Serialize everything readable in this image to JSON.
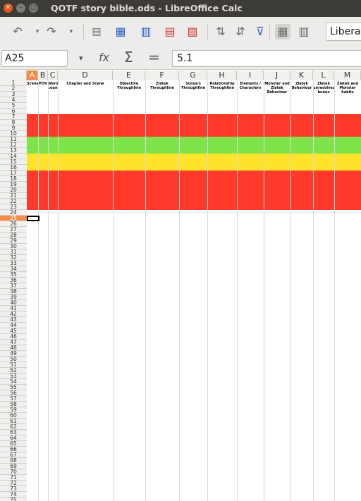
{
  "window": {
    "title": "QOTF story bible.ods - LibreOffice Calc"
  },
  "toolbar": {
    "font_name": "Liberat"
  },
  "formula_bar": {
    "cell_ref": "A25",
    "value": "5.1",
    "function_wizard": "fx",
    "sum": "Σ",
    "equals": "="
  },
  "columns": [
    "A",
    "B",
    "C",
    "D",
    "E",
    "F",
    "G",
    "H",
    "I",
    "J",
    "K",
    "L",
    "M"
  ],
  "selected_column": "A",
  "rows": [
    "1",
    "2",
    "3",
    "4",
    "5",
    "6",
    "7",
    "8",
    "9",
    "10",
    "11",
    "12",
    "13",
    "14",
    "15",
    "16",
    "17",
    "18",
    "19",
    "20",
    "21",
    "22",
    "23",
    "24",
    "25",
    "26",
    "27",
    "28",
    "29",
    "30",
    "31",
    "32",
    "33",
    "34",
    "35",
    "36",
    "37",
    "38",
    "39",
    "40",
    "41",
    "42",
    "43",
    "44",
    "45",
    "46",
    "47",
    "48",
    "49",
    "50",
    "51",
    "52",
    "53",
    "54",
    "55",
    "56",
    "57",
    "58",
    "59",
    "60",
    "61",
    "62",
    "63",
    "64",
    "65",
    "66",
    "67",
    "68",
    "69",
    "70",
    "71",
    "72",
    "73",
    "74",
    "75"
  ],
  "selected_row": "25",
  "header_row": {
    "scene": "Scene",
    "pov": "POV",
    "words": "Word count",
    "chapter": "Chapter and Scene",
    "objective": "Objective Throughline",
    "zlatek": "Zlatek Throughline",
    "sonya": "Sonya's Throughline",
    "relationship": "Relationship Throughline",
    "elements": "Elements / Characters",
    "monsters": "Monster and Zlatek Behaviour",
    "zlatek_behaviour": "Zlatek Behaviour",
    "unresolved": "Zlatek unresolved bonus",
    "zlatek_habits": "Zlatek and Monster habits"
  },
  "colors": {
    "red": "#ff3a2a",
    "green": "#7fe34a",
    "yellow": "#ffe22a",
    "selection": "#f58a4a",
    "titlebar": "#3c3b37"
  }
}
